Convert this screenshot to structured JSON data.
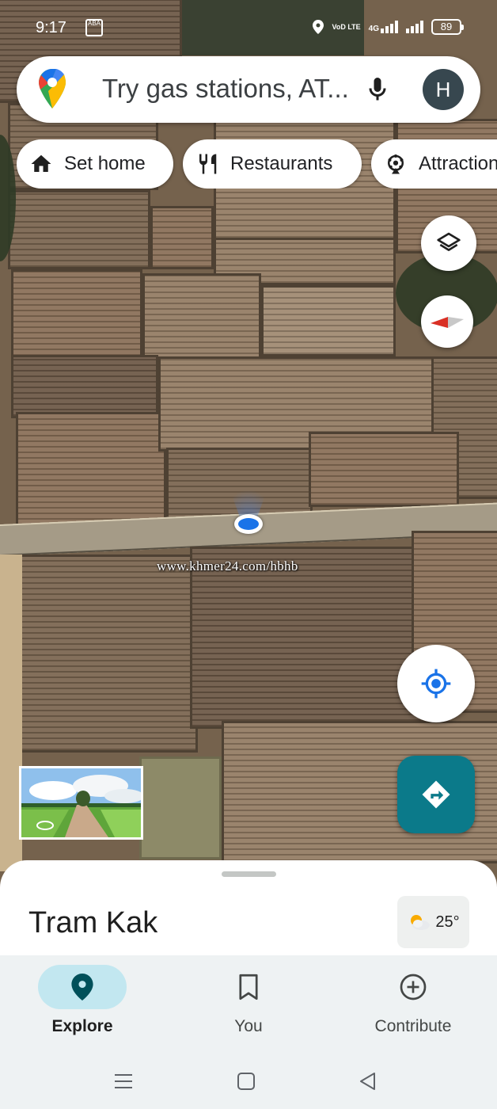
{
  "status_bar": {
    "time": "9:17",
    "app_icon_text": "ABA",
    "volte": "VoD LTE",
    "network": "4G",
    "battery": "89"
  },
  "search": {
    "placeholder": "Try gas stations, AT...",
    "avatar_initial": "H"
  },
  "chips": [
    {
      "label": "Set home",
      "icon": "home-icon"
    },
    {
      "label": "Restaurants",
      "icon": "restaurant-icon"
    },
    {
      "label": "Attractions",
      "icon": "attractions-icon"
    }
  ],
  "map": {
    "watermark": "www.khmer24.com/hbhb",
    "type": "satellite"
  },
  "sheet": {
    "place_title": "Tram Kak",
    "temperature": "25°",
    "weather_icon": "partly-cloudy-icon"
  },
  "bottom_nav": {
    "items": [
      {
        "label": "Explore",
        "icon": "explore-pin-icon",
        "active": true
      },
      {
        "label": "You",
        "icon": "bookmark-icon",
        "active": false
      },
      {
        "label": "Contribute",
        "icon": "add-circle-icon",
        "active": false
      }
    ]
  },
  "colors": {
    "accent": "#1a73e8",
    "directions_button": "#0b7a8a",
    "active_nav_pill": "#c2e7f0",
    "avatar_bg": "#37474f"
  }
}
